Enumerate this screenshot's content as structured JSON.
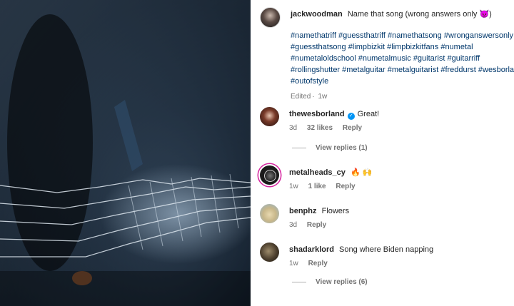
{
  "post": {
    "username": "jackwoodman",
    "caption": "Name that song (wrong answers only",
    "caption_emoji": "👿",
    "caption_end": ")",
    "hashtags": "#namethatriff #guessthatriff #namethatsong #wronganswersonly #guessthatsong #limpbizkit #limpbizkitfans #numetal #numetaloldschool #numetalmusic #guitarist #guitarriff #rollingshutter #metalguitar #metalguitarist #freddurst #wesborland #outofstyle",
    "edited": "Edited",
    "time": "1w"
  },
  "comments": [
    {
      "username": "thewesborland",
      "verified": true,
      "text": "Great!",
      "time": "3d",
      "likes": "32 likes",
      "reply": "Reply",
      "view_replies": "View replies (1)"
    },
    {
      "username": "metalheads_cy",
      "text": "🔥 🙌",
      "time": "1w",
      "likes": "1 like",
      "reply": "Reply"
    },
    {
      "username": "benphz",
      "text": "Flowers",
      "time": "3d",
      "reply": "Reply"
    },
    {
      "username": "shadarklord",
      "text": "Song where Biden napping",
      "time": "1w",
      "reply": "Reply",
      "view_replies": "View replies (6)"
    }
  ],
  "colors": {
    "link": "#00376b",
    "verified": "#0095f6",
    "meta": "#737373"
  }
}
